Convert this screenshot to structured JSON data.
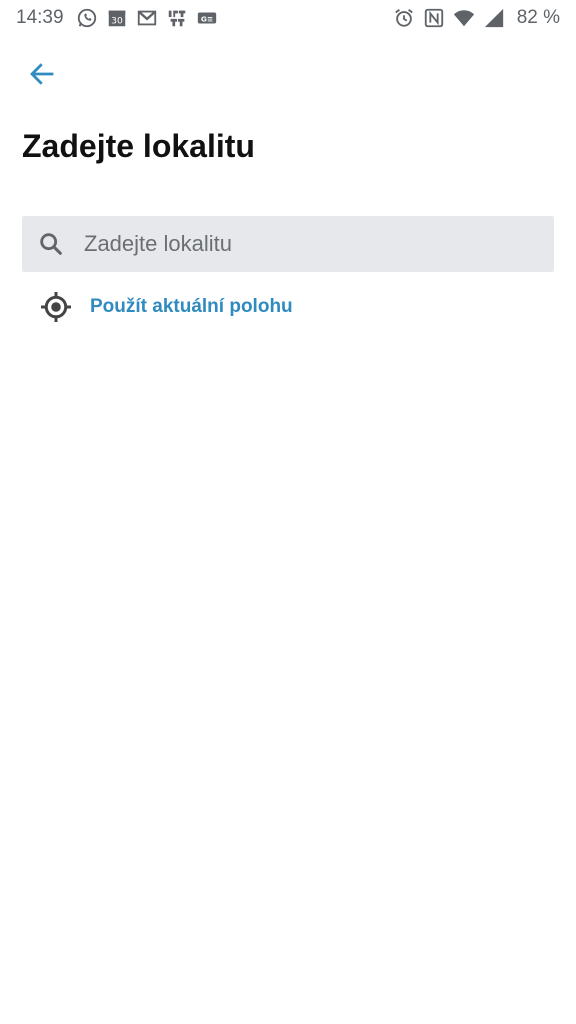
{
  "status_bar": {
    "time": "14:39",
    "battery": "82 %",
    "left_icons": [
      "whatsapp-icon",
      "calendar-icon",
      "gmail-icon",
      "ifttt-icon",
      "game-icon"
    ],
    "right_icons": [
      "alarm-icon",
      "nfc-icon",
      "wifi-icon",
      "signal-icon"
    ],
    "calendar_day": "30",
    "ifttt_text": "IFT TT",
    "game_text": "G≡"
  },
  "header": {
    "back_icon": "arrow-left-icon",
    "title": "Zadejte lokalitu"
  },
  "search": {
    "placeholder": "Zadejte lokalitu",
    "value": "",
    "icon": "search-icon"
  },
  "current_location": {
    "label": "Použít aktuální polohu",
    "icon": "gps-target-icon"
  },
  "colors": {
    "accent": "#2f8bc0",
    "search_bg": "#e6e8ec",
    "title": "#111111",
    "status_icons": "#5f6368"
  }
}
